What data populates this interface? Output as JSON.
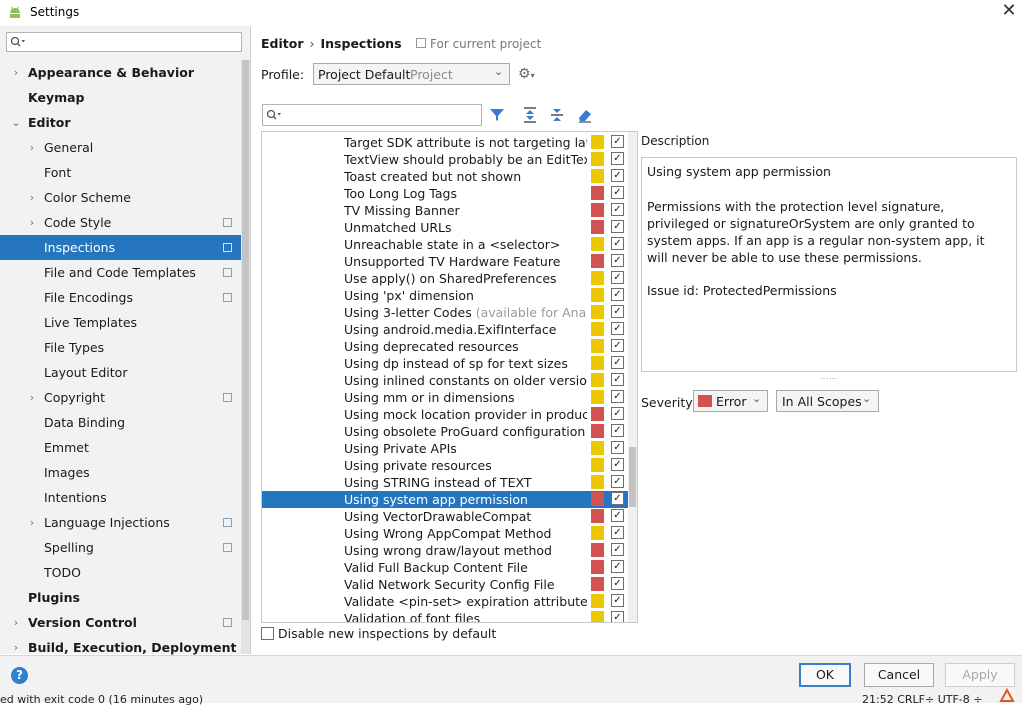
{
  "window": {
    "title": "Settings",
    "close_glyph": "✕"
  },
  "left_search": {
    "placeholder": "",
    "icon": "search-icon"
  },
  "tree": [
    {
      "label": "Appearance & Behavior",
      "level": 0,
      "arrow": "›",
      "bold": true,
      "copy": false
    },
    {
      "label": "Keymap",
      "level": 0,
      "arrow": "",
      "bold": true,
      "copy": false
    },
    {
      "label": "Editor",
      "level": 0,
      "arrow": "⌄",
      "bold": true,
      "copy": false
    },
    {
      "label": "General",
      "level": 1,
      "arrow": "›",
      "bold": false,
      "copy": false
    },
    {
      "label": "Font",
      "level": 1,
      "arrow": "",
      "bold": false,
      "copy": false
    },
    {
      "label": "Color Scheme",
      "level": 1,
      "arrow": "›",
      "bold": false,
      "copy": false
    },
    {
      "label": "Code Style",
      "level": 1,
      "arrow": "›",
      "bold": false,
      "copy": true
    },
    {
      "label": "Inspections",
      "level": 1,
      "arrow": "",
      "bold": false,
      "copy": true,
      "selected": true
    },
    {
      "label": "File and Code Templates",
      "level": 1,
      "arrow": "",
      "bold": false,
      "copy": true
    },
    {
      "label": "File Encodings",
      "level": 1,
      "arrow": "",
      "bold": false,
      "copy": true
    },
    {
      "label": "Live Templates",
      "level": 1,
      "arrow": "",
      "bold": false,
      "copy": false
    },
    {
      "label": "File Types",
      "level": 1,
      "arrow": "",
      "bold": false,
      "copy": false
    },
    {
      "label": "Layout Editor",
      "level": 1,
      "arrow": "",
      "bold": false,
      "copy": false
    },
    {
      "label": "Copyright",
      "level": 1,
      "arrow": "›",
      "bold": false,
      "copy": true
    },
    {
      "label": "Data Binding",
      "level": 1,
      "arrow": "",
      "bold": false,
      "copy": false
    },
    {
      "label": "Emmet",
      "level": 1,
      "arrow": "",
      "bold": false,
      "copy": false
    },
    {
      "label": "Images",
      "level": 1,
      "arrow": "",
      "bold": false,
      "copy": false
    },
    {
      "label": "Intentions",
      "level": 1,
      "arrow": "",
      "bold": false,
      "copy": false
    },
    {
      "label": "Language Injections",
      "level": 1,
      "arrow": "›",
      "bold": false,
      "copy": true
    },
    {
      "label": "Spelling",
      "level": 1,
      "arrow": "",
      "bold": false,
      "copy": true
    },
    {
      "label": "TODO",
      "level": 1,
      "arrow": "",
      "bold": false,
      "copy": false
    },
    {
      "label": "Plugins",
      "level": 0,
      "arrow": "",
      "bold": true,
      "copy": false
    },
    {
      "label": "Version Control",
      "level": 0,
      "arrow": "›",
      "bold": true,
      "copy": true
    },
    {
      "label": "Build, Execution, Deployment",
      "level": 0,
      "arrow": "›",
      "bold": true,
      "copy": false
    }
  ],
  "header": {
    "crumb1": "Editor",
    "crumb_sep": "›",
    "crumb2": "Inspections",
    "for_project": "For current project",
    "profile_label": "Profile:",
    "profile_value": "Project Default",
    "profile_scope": "Project"
  },
  "colors": {
    "error": "#d25252",
    "warning": "#ecc800",
    "selection": "#2675bf"
  },
  "inspections": [
    {
      "name": "Target SDK attribute is not targeting latest",
      "severity": "warning",
      "checked": true
    },
    {
      "name": "TextView should probably be an EditText",
      "severity": "warning",
      "checked": true
    },
    {
      "name": "Toast created but not shown",
      "severity": "warning",
      "checked": true
    },
    {
      "name": "Too Long Log Tags",
      "severity": "error",
      "checked": true
    },
    {
      "name": "TV Missing Banner",
      "severity": "error",
      "checked": true
    },
    {
      "name": "Unmatched URLs",
      "severity": "error",
      "checked": true
    },
    {
      "name": "Unreachable state in a <selector>",
      "severity": "warning",
      "checked": true
    },
    {
      "name": "Unsupported TV Hardware Feature",
      "severity": "error",
      "checked": true
    },
    {
      "name": "Use apply() on SharedPreferences",
      "severity": "warning",
      "checked": true
    },
    {
      "name": "Using 'px' dimension",
      "severity": "warning",
      "checked": true
    },
    {
      "name": "Using 3-letter Codes",
      "dim": " (available for Analyz",
      "severity": "warning",
      "checked": true
    },
    {
      "name": "Using android.media.ExifInterface",
      "severity": "warning",
      "checked": true
    },
    {
      "name": "Using deprecated resources",
      "severity": "warning",
      "checked": true
    },
    {
      "name": "Using dp instead of sp for text sizes",
      "severity": "warning",
      "checked": true
    },
    {
      "name": "Using inlined constants on older versions",
      "severity": "warning",
      "checked": true
    },
    {
      "name": "Using mm or in dimensions",
      "severity": "warning",
      "checked": true
    },
    {
      "name": "Using mock location provider in production",
      "severity": "error",
      "checked": true
    },
    {
      "name": "Using obsolete ProGuard configuration",
      "severity": "error",
      "checked": true
    },
    {
      "name": "Using Private APIs",
      "severity": "warning",
      "checked": true
    },
    {
      "name": "Using private resources",
      "severity": "warning",
      "checked": true
    },
    {
      "name": "Using STRING instead of TEXT",
      "severity": "warning",
      "checked": true
    },
    {
      "name": "Using system app permission",
      "severity": "error",
      "checked": true,
      "selected": true
    },
    {
      "name": "Using VectorDrawableCompat",
      "severity": "error",
      "checked": true
    },
    {
      "name": "Using Wrong AppCompat Method",
      "severity": "warning",
      "checked": true
    },
    {
      "name": "Using wrong draw/layout method",
      "severity": "error",
      "checked": true
    },
    {
      "name": "Valid Full Backup Content File",
      "severity": "error",
      "checked": true
    },
    {
      "name": "Valid Network Security Config File",
      "severity": "error",
      "checked": true
    },
    {
      "name": "Validate <pin-set> expiration attribute",
      "severity": "warning",
      "checked": true
    },
    {
      "name": "Validation of font files",
      "severity": "warning",
      "checked": true
    }
  ],
  "disable_new": {
    "label": "Disable new inspections by default",
    "checked": false
  },
  "description": {
    "title": "Description",
    "heading": "Using system app permission",
    "body": "Permissions with the protection level signature, privileged or signatureOrSystem are only granted to system apps. If an app is a regular non-system app, it will never be able to use these permissions.",
    "issue": "Issue id: ProtectedPermissions"
  },
  "severity": {
    "label": "Severity:",
    "value": "Error",
    "scope": "In All Scopes"
  },
  "buttons": {
    "ok": "OK",
    "cancel": "Cancel",
    "apply": "Apply"
  },
  "status": {
    "left": "ed with exit code 0 (16 minutes ago)",
    "right": "21:52   CRLF÷   UTF-8 ÷"
  }
}
